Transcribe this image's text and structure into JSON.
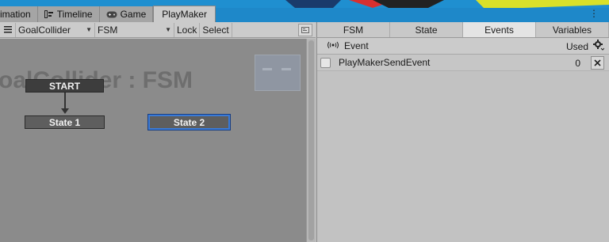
{
  "top_tabs": [
    {
      "label": "imation",
      "icon": "animation-icon"
    },
    {
      "label": "Timeline",
      "icon": "timeline-icon"
    },
    {
      "label": "Game",
      "icon": "gamepad-icon"
    },
    {
      "label": "PlayMaker",
      "icon": null,
      "active": true
    }
  ],
  "window_menu_icon": "kebab-menu-icon",
  "toolbar": {
    "menu_icon": "hamburger-icon",
    "object_select": "GoalCollider",
    "fsm_select": "FSM",
    "lock_label": "Lock",
    "select_label": "Select",
    "end_icon": "layout-icon"
  },
  "canvas": {
    "watermark": "oalCollider : FSM",
    "nodes": {
      "start": "START",
      "state1": "State 1",
      "state2": "State 2"
    }
  },
  "panel": {
    "tabs": [
      "FSM",
      "State",
      "Events",
      "Variables"
    ],
    "active_tab": "Events",
    "header": {
      "icon": "broadcast-icon",
      "title": "Event",
      "used_label": "Used",
      "settings_icon": "gear-icon"
    },
    "events": [
      {
        "name": "PlayMakerSendEvent",
        "used": "0",
        "checked": false
      }
    ]
  },
  "colors": {
    "selected_state_border": "#3a7ad6",
    "canvas_bg": "#8b8b8b"
  }
}
